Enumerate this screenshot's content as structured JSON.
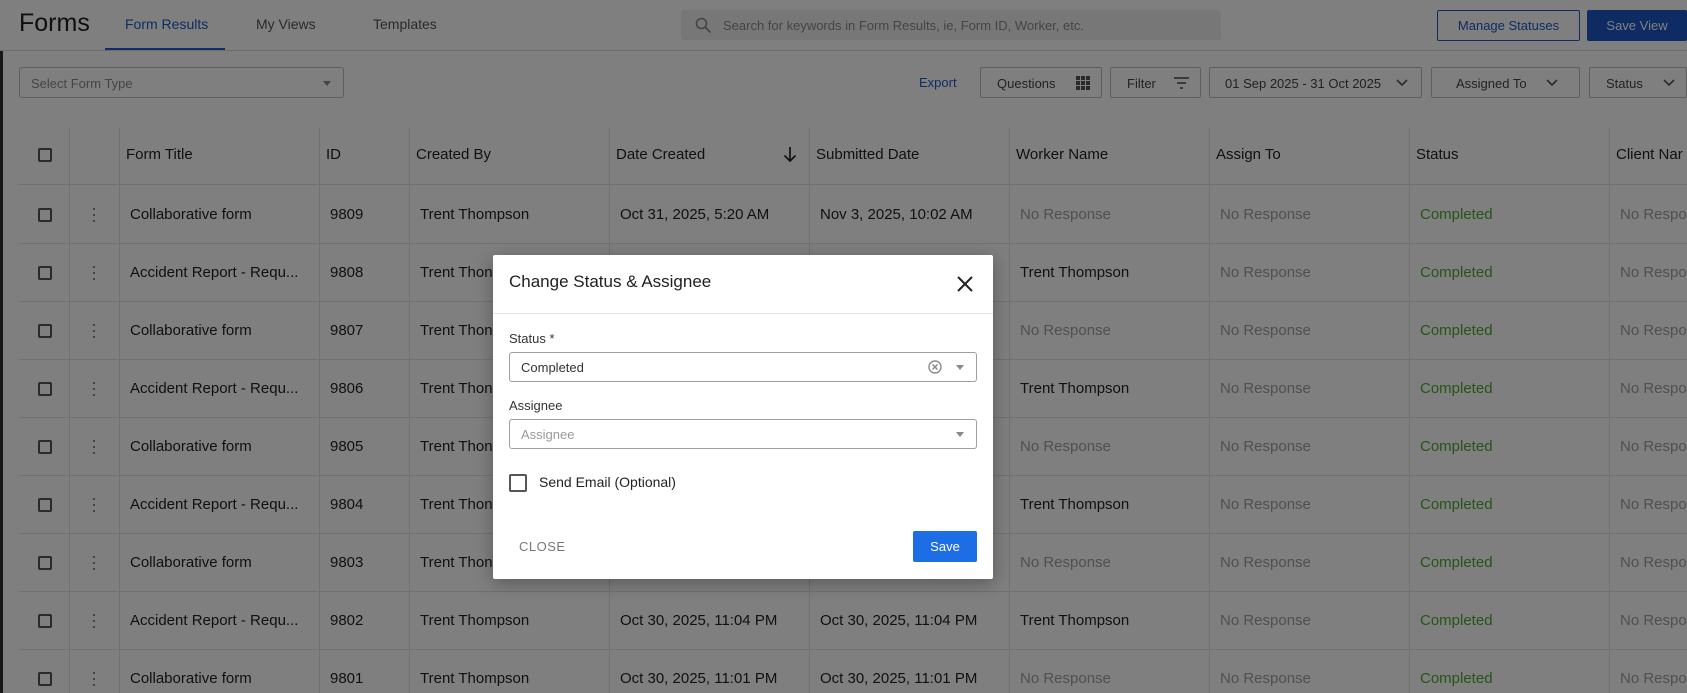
{
  "app": {
    "title": "Forms"
  },
  "tabs": [
    {
      "label": "Form Results",
      "active": true
    },
    {
      "label": "My Views",
      "active": false
    },
    {
      "label": "Templates",
      "active": false
    }
  ],
  "search": {
    "placeholder": "Search for keywords in Form Results, ie, Form ID, Worker, etc."
  },
  "header_buttons": {
    "manage_statuses": "Manage Statuses",
    "save_view": "Save View"
  },
  "toolbar": {
    "form_type_placeholder": "Select Form Type",
    "export": "Export",
    "questions": "Questions",
    "filter": "Filter",
    "date_range": "01 Sep 2025 - 31 Oct 2025",
    "assigned_to": "Assigned To",
    "status": "Status"
  },
  "table": {
    "columns": [
      "Form Title",
      "ID",
      "Created By",
      "Date Created",
      "Submitted Date",
      "Worker Name",
      "Assign To",
      "Status",
      "Client Nar"
    ],
    "rows": [
      {
        "title": "Collaborative form",
        "id": "9809",
        "created_by": "Trent Thompson",
        "date_created": "Oct 31, 2025, 5:20 AM",
        "submitted": "Nov 3, 2025, 10:02 AM",
        "worker": "No Response",
        "assign_to": "No Response",
        "status": "Completed",
        "client": "No Respo"
      },
      {
        "title": "Accident Report - Requ...",
        "id": "9808",
        "created_by": "Trent Thon",
        "date_created": "",
        "submitted": "",
        "worker": "Trent Thompson",
        "assign_to": "No Response",
        "status": "Completed",
        "client": "No Respo"
      },
      {
        "title": "Collaborative form",
        "id": "9807",
        "created_by": "Trent Thon",
        "date_created": "",
        "submitted": "",
        "worker": "No Response",
        "assign_to": "No Response",
        "status": "Completed",
        "client": "No Respo"
      },
      {
        "title": "Accident Report - Requ...",
        "id": "9806",
        "created_by": "Trent Thon",
        "date_created": "",
        "submitted": "",
        "worker": "Trent Thompson",
        "assign_to": "No Response",
        "status": "Completed",
        "client": "No Respo"
      },
      {
        "title": "Collaborative form",
        "id": "9805",
        "created_by": "Trent Thon",
        "date_created": "",
        "submitted": "",
        "worker": "No Response",
        "assign_to": "No Response",
        "status": "Completed",
        "client": "No Respo"
      },
      {
        "title": "Accident Report - Requ...",
        "id": "9804",
        "created_by": "Trent Thon",
        "date_created": "",
        "submitted": "",
        "worker": "Trent Thompson",
        "assign_to": "No Response",
        "status": "Completed",
        "client": "No Respo"
      },
      {
        "title": "Collaborative form",
        "id": "9803",
        "created_by": "Trent Thon",
        "date_created": "",
        "submitted": "",
        "worker": "No Response",
        "assign_to": "No Response",
        "status": "Completed",
        "client": "No Respo"
      },
      {
        "title": "Accident Report - Requ...",
        "id": "9802",
        "created_by": "Trent Thompson",
        "date_created": "Oct 30, 2025, 11:04 PM",
        "submitted": "Oct 30, 2025, 11:04 PM",
        "worker": "Trent Thompson",
        "assign_to": "No Response",
        "status": "Completed",
        "client": "No Respo"
      },
      {
        "title": "Collaborative form",
        "id": "9801",
        "created_by": "Trent Thompson",
        "date_created": "Oct 30, 2025, 11:01 PM",
        "submitted": "Oct 30, 2025, 11:01 PM",
        "worker": "No Response",
        "assign_to": "No Response",
        "status": "Completed",
        "client": "No Respo"
      }
    ]
  },
  "modal": {
    "title": "Change Status & Assignee",
    "status_label": "Status *",
    "status_value": "Completed",
    "assignee_label": "Assignee",
    "assignee_placeholder": "Assignee",
    "send_email_label": "Send Email (Optional)",
    "close_label": "CLOSE",
    "save_label": "Save"
  },
  "colors": {
    "accent": "#1d58c6",
    "status_completed": "#4caa2e",
    "muted_text": "#a0a0a0",
    "save_button": "#1d6de6"
  }
}
